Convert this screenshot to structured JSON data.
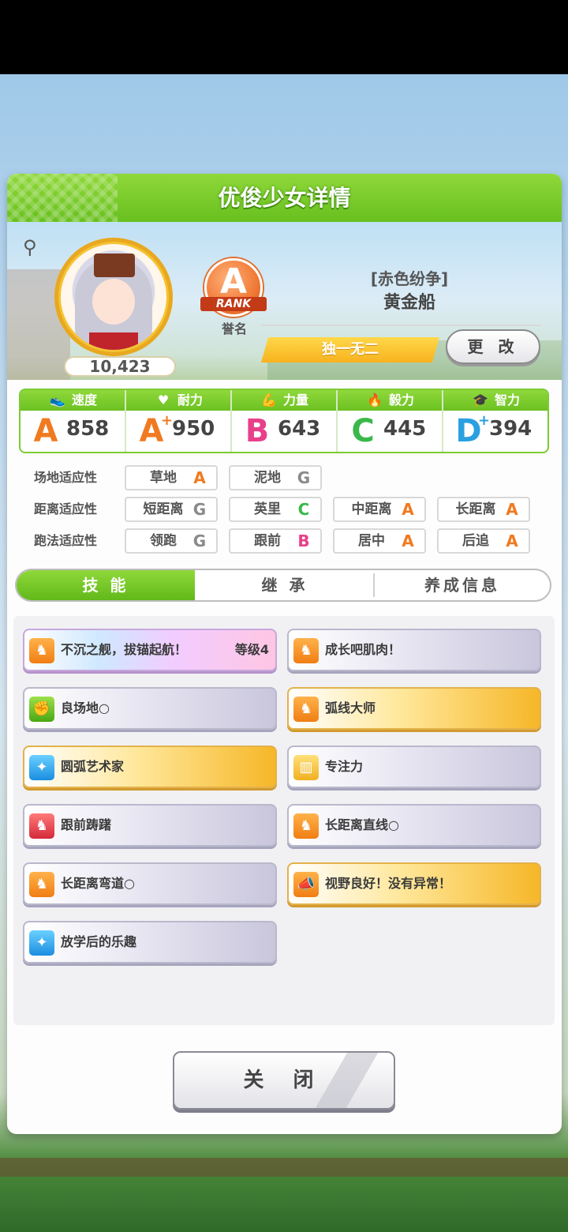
{
  "header": {
    "title": "优俊少女详情"
  },
  "profile": {
    "score": "10,423",
    "rank_letter": "A",
    "rank_word": "RANK",
    "rank_caption": "誉名",
    "costume": "[赤色纷争]",
    "name": "黄金船",
    "title_tag": "独一无二",
    "change_label": "更 改"
  },
  "stats": [
    {
      "label": "速度",
      "icon": "shoe-icon",
      "grade": "A",
      "plus": "",
      "value": "858",
      "color": "#f07a20"
    },
    {
      "label": "耐力",
      "icon": "heart-icon",
      "grade": "A",
      "plus": "+",
      "value": "950",
      "color": "#f07a20"
    },
    {
      "label": "力量",
      "icon": "muscle-icon",
      "grade": "B",
      "plus": "",
      "value": "643",
      "color": "#e8408a"
    },
    {
      "label": "毅力",
      "icon": "flame-icon",
      "grade": "C",
      "plus": "",
      "value": "445",
      "color": "#3ab84a"
    },
    {
      "label": "智力",
      "icon": "graduation-cap-icon",
      "grade": "D",
      "plus": "+",
      "value": "394",
      "color": "#2aa0e0"
    }
  ],
  "aptitude": {
    "rows": [
      {
        "label": "场地适应性",
        "items": [
          {
            "name": "草地",
            "grade": "A",
            "color": "#f07a20"
          },
          {
            "name": "泥地",
            "grade": "G",
            "color": "#8a8a8a"
          }
        ]
      },
      {
        "label": "距离适应性",
        "items": [
          {
            "name": "短距离",
            "grade": "G",
            "color": "#8a8a8a"
          },
          {
            "name": "英里",
            "grade": "C",
            "color": "#3ab84a"
          },
          {
            "name": "中距离",
            "grade": "A",
            "color": "#f07a20"
          },
          {
            "name": "长距离",
            "grade": "A",
            "color": "#f07a20"
          }
        ]
      },
      {
        "label": "跑法适应性",
        "items": [
          {
            "name": "领跑",
            "grade": "G",
            "color": "#8a8a8a"
          },
          {
            "name": "跟前",
            "grade": "B",
            "color": "#e8408a"
          },
          {
            "name": "居中",
            "grade": "A",
            "color": "#f07a20"
          },
          {
            "name": "后追",
            "grade": "A",
            "color": "#f07a20"
          }
        ]
      }
    ]
  },
  "tabs": [
    {
      "label": "技 能",
      "active": true
    },
    {
      "label": "继 承",
      "active": false
    },
    {
      "label": "养成信息",
      "active": false
    }
  ],
  "skills": [
    {
      "name": "不沉之舰，拔锚起航！",
      "level": "等级4",
      "style": "rainbow",
      "icon": "running-horse-icon",
      "icon_color": "orange"
    },
    {
      "name": "成长吧肌肉！",
      "level": "",
      "style": "silver",
      "icon": "running-horse-icon",
      "icon_color": "orange"
    },
    {
      "name": "良场地○",
      "level": "",
      "style": "silver",
      "icon": "muscle-icon",
      "icon_color": "green"
    },
    {
      "name": "弧线大师",
      "level": "",
      "style": "gold",
      "icon": "running-horse-icon",
      "icon_color": "orange"
    },
    {
      "name": "圆弧艺术家",
      "level": "",
      "style": "gold",
      "icon": "sparkle-icon",
      "icon_color": "blue"
    },
    {
      "name": "专注力",
      "level": "",
      "style": "silver",
      "icon": "gate-icon",
      "icon_color": "yellow"
    },
    {
      "name": "跟前踌躇",
      "level": "",
      "style": "silver",
      "icon": "horse-debuff-icon",
      "icon_color": "red"
    },
    {
      "name": "长距离直线○",
      "level": "",
      "style": "silver",
      "icon": "running-horse-icon",
      "icon_color": "orange"
    },
    {
      "name": "长距离弯道○",
      "level": "",
      "style": "silver",
      "icon": "running-horse-icon",
      "icon_color": "orange"
    },
    {
      "name": "视野良好！没有异常！",
      "level": "",
      "style": "gold",
      "icon": "megaphone-icon",
      "icon_color": "orange"
    },
    {
      "name": "放学后的乐趣",
      "level": "",
      "style": "silver",
      "icon": "sparkle-icon",
      "icon_color": "blue"
    }
  ],
  "close_label": "关 闭"
}
